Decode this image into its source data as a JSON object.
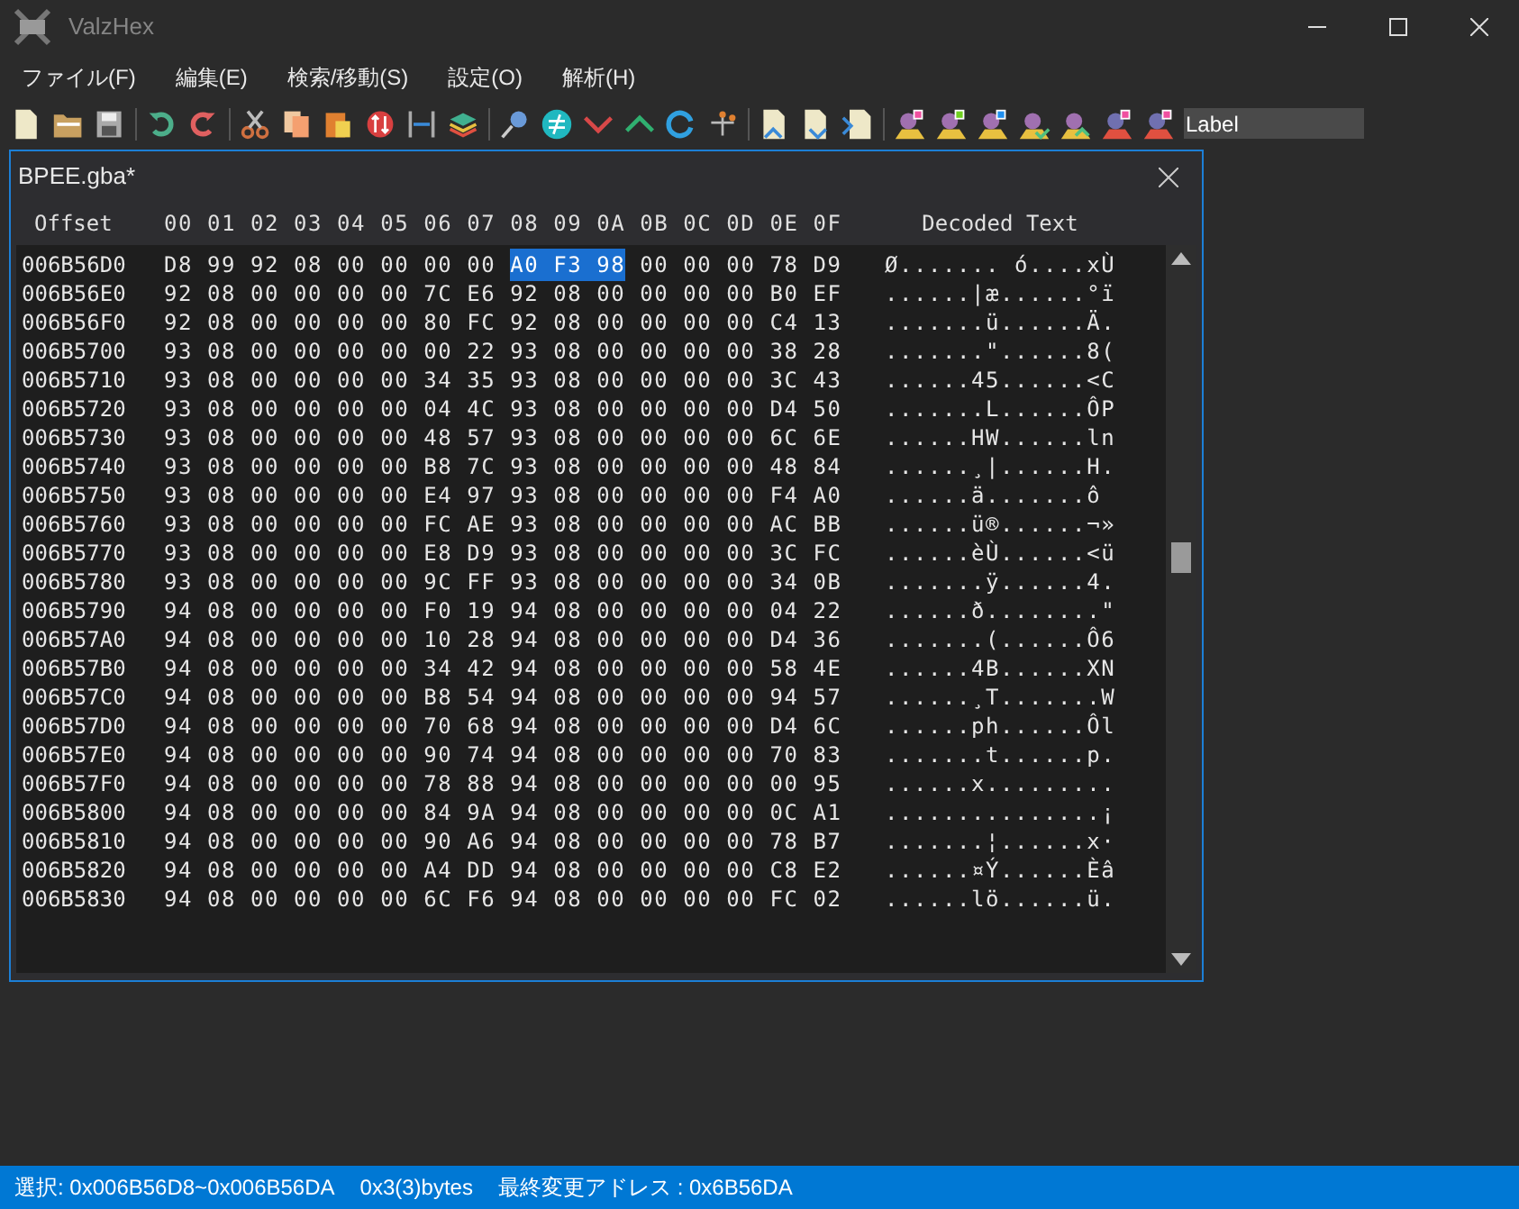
{
  "window": {
    "title": "ValzHex"
  },
  "menu": [
    "ファイル(F)",
    "編集(E)",
    "検索/移動(S)",
    "設定(O)",
    "解析(H)"
  ],
  "toolbar": {
    "label_field": {
      "value": "Label"
    }
  },
  "document": {
    "title": "BPEE.gba*",
    "columns": {
      "offset": "Offset",
      "bytes": "00 01 02 03 04 05 06 07 08 09 0A 0B 0C 0D 0E 0F",
      "decoded": "Decoded Text"
    },
    "rows": [
      {
        "offset": "006B56D0",
        "segments": [
          {
            "text": "D8 99 92 08 00 00 00 00",
            "selected": false
          },
          {
            "text": "A0 F3 98",
            "selected": true
          },
          {
            "text": "00 00 00 78 D9",
            "selected": false
          }
        ],
        "decoded": "Ø....... ó....xÙ"
      },
      {
        "offset": "006B56E0",
        "segments": [
          {
            "text": "92 08 00 00 00 00 7C E6 92 08 00 00 00 00 B0 EF",
            "selected": false
          }
        ],
        "decoded": "......|æ......°ï"
      },
      {
        "offset": "006B56F0",
        "segments": [
          {
            "text": "92 08 00 00 00 00 80 FC 92 08 00 00 00 00 C4 13",
            "selected": false
          }
        ],
        "decoded": ".......ü......Ä."
      },
      {
        "offset": "006B5700",
        "segments": [
          {
            "text": "93 08 00 00 00 00 00 22 93 08 00 00 00 00 38 28",
            "selected": false
          }
        ],
        "decoded": ".......\"......8("
      },
      {
        "offset": "006B5710",
        "segments": [
          {
            "text": "93 08 00 00 00 00 34 35 93 08 00 00 00 00 3C 43",
            "selected": false
          }
        ],
        "decoded": "......45......<C"
      },
      {
        "offset": "006B5720",
        "segments": [
          {
            "text": "93 08 00 00 00 00 04 4C 93 08 00 00 00 00 D4 50",
            "selected": false
          }
        ],
        "decoded": ".......L......ÔP"
      },
      {
        "offset": "006B5730",
        "segments": [
          {
            "text": "93 08 00 00 00 00 48 57 93 08 00 00 00 00 6C 6E",
            "selected": false
          }
        ],
        "decoded": "......HW......ln"
      },
      {
        "offset": "006B5740",
        "segments": [
          {
            "text": "93 08 00 00 00 00 B8 7C 93 08 00 00 00 00 48 84",
            "selected": false
          }
        ],
        "decoded": "......¸|......H."
      },
      {
        "offset": "006B5750",
        "segments": [
          {
            "text": "93 08 00 00 00 00 E4 97 93 08 00 00 00 00 F4 A0",
            "selected": false
          }
        ],
        "decoded": "......ä.......ô"
      },
      {
        "offset": "006B5760",
        "segments": [
          {
            "text": "93 08 00 00 00 00 FC AE 93 08 00 00 00 00 AC BB",
            "selected": false
          }
        ],
        "decoded": "......ü®......¬»"
      },
      {
        "offset": "006B5770",
        "segments": [
          {
            "text": "93 08 00 00 00 00 E8 D9 93 08 00 00 00 00 3C FC",
            "selected": false
          }
        ],
        "decoded": "......èÙ......<ü"
      },
      {
        "offset": "006B5780",
        "segments": [
          {
            "text": "93 08 00 00 00 00 9C FF 93 08 00 00 00 00 34 0B",
            "selected": false
          }
        ],
        "decoded": ".......ÿ......4."
      },
      {
        "offset": "006B5790",
        "segments": [
          {
            "text": "94 08 00 00 00 00 F0 19 94 08 00 00 00 00 04 22",
            "selected": false
          }
        ],
        "decoded": "......ð........\""
      },
      {
        "offset": "006B57A0",
        "segments": [
          {
            "text": "94 08 00 00 00 00 10 28 94 08 00 00 00 00 D4 36",
            "selected": false
          }
        ],
        "decoded": ".......(......Ô6"
      },
      {
        "offset": "006B57B0",
        "segments": [
          {
            "text": "94 08 00 00 00 00 34 42 94 08 00 00 00 00 58 4E",
            "selected": false
          }
        ],
        "decoded": "......4B......XN"
      },
      {
        "offset": "006B57C0",
        "segments": [
          {
            "text": "94 08 00 00 00 00 B8 54 94 08 00 00 00 00 94 57",
            "selected": false
          }
        ],
        "decoded": "......¸T.......W"
      },
      {
        "offset": "006B57D0",
        "segments": [
          {
            "text": "94 08 00 00 00 00 70 68 94 08 00 00 00 00 D4 6C",
            "selected": false
          }
        ],
        "decoded": "......ph......Ôl"
      },
      {
        "offset": "006B57E0",
        "segments": [
          {
            "text": "94 08 00 00 00 00 90 74 94 08 00 00 00 00 70 83",
            "selected": false
          }
        ],
        "decoded": ".......t......p."
      },
      {
        "offset": "006B57F0",
        "segments": [
          {
            "text": "94 08 00 00 00 00 78 88 94 08 00 00 00 00 00 95",
            "selected": false
          }
        ],
        "decoded": "......x........."
      },
      {
        "offset": "006B5800",
        "segments": [
          {
            "text": "94 08 00 00 00 00 84 9A 94 08 00 00 00 00 0C A1",
            "selected": false
          }
        ],
        "decoded": "...............¡"
      },
      {
        "offset": "006B5810",
        "segments": [
          {
            "text": "94 08 00 00 00 00 90 A6 94 08 00 00 00 00 78 B7",
            "selected": false
          }
        ],
        "decoded": ".......¦......x·"
      },
      {
        "offset": "006B5820",
        "segments": [
          {
            "text": "94 08 00 00 00 00 A4 DD 94 08 00 00 00 00 C8 E2",
            "selected": false
          }
        ],
        "decoded": "......¤Ý......Èâ"
      },
      {
        "offset": "006B5830",
        "segments": [
          {
            "text": "94 08 00 00 00 00 6C F6 94 08 00 00 00 00 FC 02",
            "selected": false
          }
        ],
        "decoded": "......lö......ü."
      }
    ]
  },
  "status_bar": [
    "選択: 0x006B56D8~0x006B56DA",
    "0x3(3)bytes",
    "最終変更アドレス : 0x6B56DA"
  ]
}
